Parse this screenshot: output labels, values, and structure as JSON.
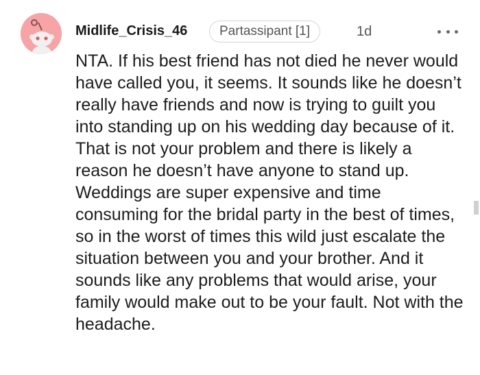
{
  "comment": {
    "username": "Midlife_Crisis_46",
    "flair": "Partassipant [1]",
    "timestamp": "1d",
    "more_icon": "ellipsis-icon",
    "avatar_icon": "snoo-avatar-icon",
    "body": "NTA. If his best friend has not died he never would have called you, it seems. It sounds like he doesn’t really have friends and now is trying to guilt you into standing up on his wedding day because of it. That is not your problem and there is likely a reason he doesn’t have anyone to stand up. Weddings are super expensive and time consuming for the bridal party in the best of times, so in the worst of times this wild just escalate the situation between you and your brother. And it sounds like any problems that would arise, your family would make out to be your fault. Not with the headache."
  },
  "colors": {
    "avatar_background": "#f7a4a7",
    "text": "#1c1c1c",
    "muted_text": "#555555",
    "flair_border": "#d6d6d6"
  }
}
